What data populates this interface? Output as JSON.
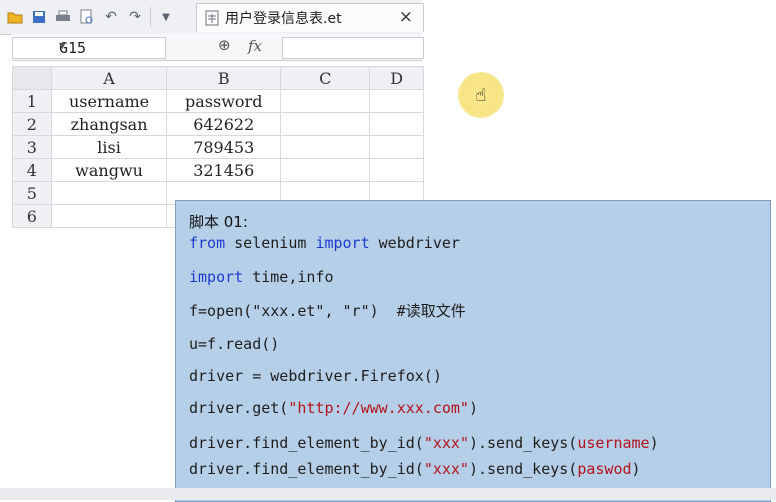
{
  "file_tab": {
    "name": "用户登录信息表.et",
    "close_icon": "×"
  },
  "formula_bar": {
    "cell_ref": "G15",
    "fx_label": "fx",
    "value": ""
  },
  "sheet": {
    "columns": [
      "A",
      "B",
      "C",
      "D"
    ],
    "rows": [
      {
        "num": "1",
        "cells": [
          "username",
          "password",
          "",
          ""
        ]
      },
      {
        "num": "2",
        "cells": [
          "zhangsan",
          "642622",
          "",
          ""
        ]
      },
      {
        "num": "3",
        "cells": [
          "lisi",
          "789453",
          "",
          ""
        ]
      },
      {
        "num": "4",
        "cells": [
          "wangwu",
          "321456",
          "",
          ""
        ]
      },
      {
        "num": "5",
        "cells": [
          "",
          "",
          "",
          ""
        ]
      },
      {
        "num": "6",
        "cells": [
          "",
          "",
          "",
          ""
        ]
      }
    ]
  },
  "code": {
    "title": "脚本 01:",
    "line1": {
      "kw1": "from",
      "t1": " selenium ",
      "kw2": "import",
      "t2": " webdriver"
    },
    "line2": {
      "kw1": "import",
      "t1": " time,info"
    },
    "line3": {
      "text": "f=open(\"xxx.et\", \"r\")  #读取文件"
    },
    "line4": {
      "text": "u=f.read()"
    },
    "line5": {
      "text": "driver = webdriver.Firefox()"
    },
    "line6": {
      "t1": "driver.get(",
      "s1": "\"http://www.xxx.com\"",
      "t2": ")"
    },
    "line7": {
      "t1": "driver.find_element_by_id(",
      "s1": "\"xxx\"",
      "t2": ").send_keys(",
      "s2": "username",
      "t3": ")"
    },
    "line8": {
      "t1": "driver.find_element_by_id(",
      "s1": "\"xxx\"",
      "t2": ").send_keys(",
      "s2": "paswod",
      "t3": ")"
    }
  },
  "colors": {
    "panel_bg": "#b6cfe8",
    "keyword": "#1c3cd1",
    "string": "#b3131b"
  }
}
